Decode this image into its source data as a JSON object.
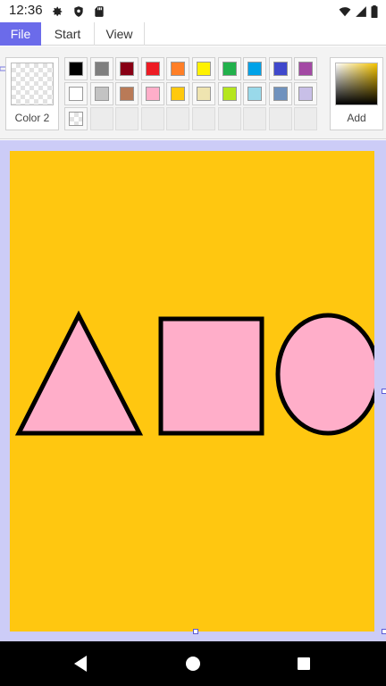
{
  "status_bar": {
    "time": "12:36",
    "icons": [
      "settings-gear-icon",
      "shield-icon",
      "sd-card-icon",
      "wifi-icon",
      "signal-icon",
      "battery-icon"
    ]
  },
  "menu_tabs": [
    {
      "label": "File",
      "active": true
    },
    {
      "label": "Start",
      "active": false
    },
    {
      "label": "View",
      "active": false
    }
  ],
  "ribbon": {
    "color2_label": "Color 2",
    "add_label": "Add",
    "palette_row1": [
      "#000000",
      "#7f7f7f",
      "#880015",
      "#ed1c24",
      "#ff7f27",
      "#fff200",
      "#22b14c",
      "#00a2e8",
      "#3f48cc",
      "#a349a4"
    ],
    "palette_row2": [
      "#ffffff",
      "#c3c3c3",
      "#b97a57",
      "#ffaec9",
      "#ffc90e",
      "#efe4b0",
      "#b5e61d",
      "#99d9ea",
      "#7092be",
      "#c8bfe7"
    ],
    "custom_row_slots": 10
  },
  "canvas": {
    "background": "#ffc710",
    "shape_fill": "#ffaec9",
    "shape_stroke": "#000000",
    "shapes": [
      "triangle",
      "rectangle",
      "ellipse"
    ]
  },
  "colors": {
    "accent": "#6b6bea",
    "workspace": "#ccccf7"
  },
  "nav_bar": {
    "buttons": [
      "back-icon",
      "home-icon",
      "recents-icon"
    ]
  }
}
